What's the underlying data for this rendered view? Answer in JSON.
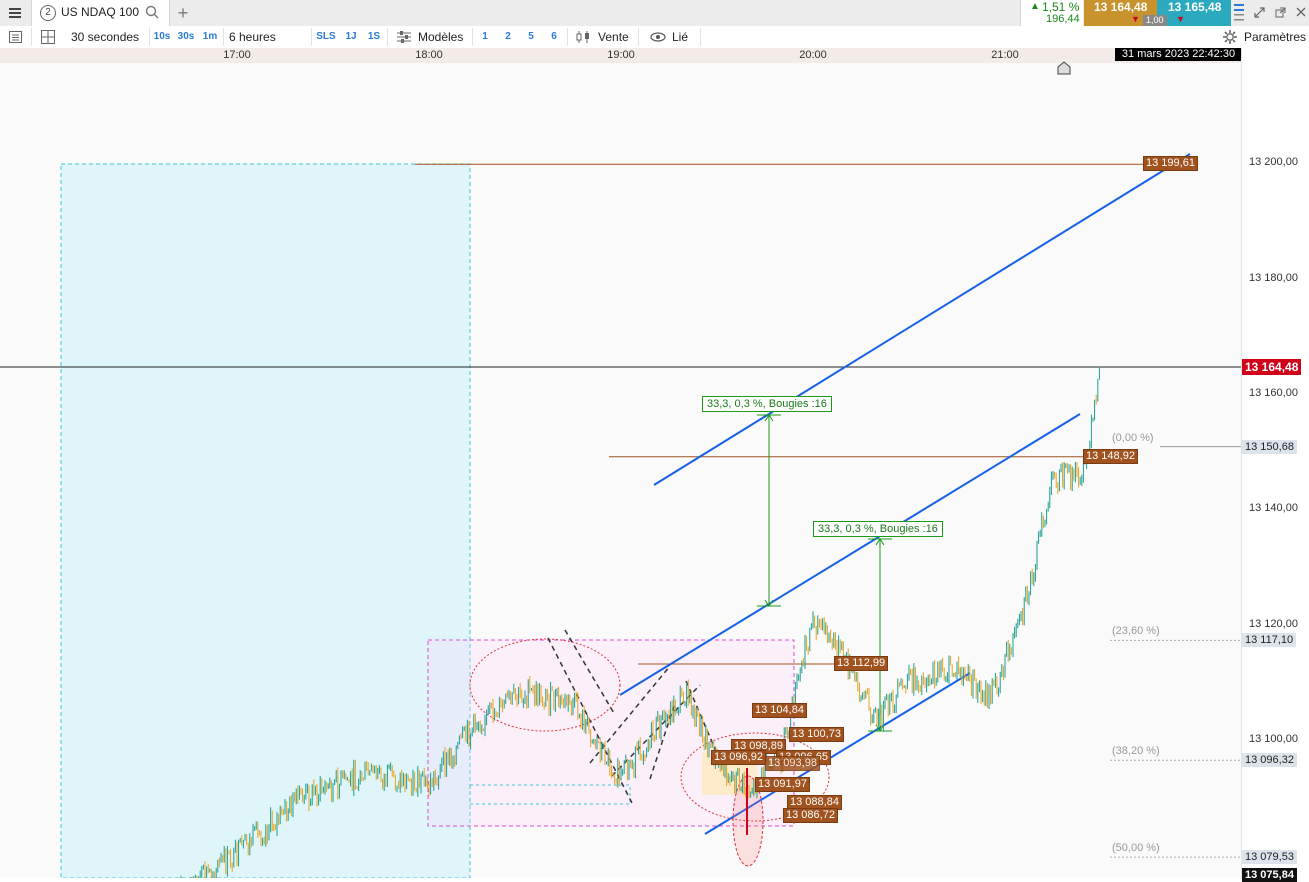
{
  "header": {
    "tab_number": "2",
    "instrument": "US NDAQ 100",
    "change_pct": "1,51 %",
    "change_abs": "196,44",
    "bid": "13 164,48",
    "ask": "13 165,48",
    "spread": "1,00"
  },
  "toolbar": {
    "period": "30 secondes",
    "btn_10s": "10s",
    "btn_30s": "30s",
    "btn_1m": "1m",
    "range": "6 heures",
    "btn_sls": "SLS",
    "btn_1j": "1J",
    "btn_1s": "1S",
    "models": "Modèles",
    "n1": "1",
    "n2": "2",
    "n5": "5",
    "n6": "6",
    "sell": "Vente",
    "linked": "Lié",
    "settings": "Paramètres"
  },
  "colors": {
    "up": "#1a9e8f",
    "down": "#e8a21c",
    "trend": "#1560e8",
    "level": "#a0521f",
    "measure": "#1b9a1b",
    "bid_bg": "#c8922c",
    "ask_bg": "#2aa9bf",
    "last_price_bg": "#d0021b"
  },
  "chart_data": {
    "type": "candlestick",
    "x_ticks": [
      "17:00",
      "18:00",
      "19:00",
      "20:00",
      "21:00"
    ],
    "datetime": "31 mars 2023 22:42:30",
    "y_ticks": [
      "13 200,00",
      "13 180,00",
      "13 160,00",
      "13 140,00",
      "13 120,00",
      "13 100,00"
    ],
    "ylim": [
      13073,
      13212
    ],
    "last_price": "13 164,48",
    "axis_marks": [
      {
        "label": "13 150,68",
        "value": 13150.68
      },
      {
        "label": "13 117,10",
        "value": 13117.1
      },
      {
        "label": "13 096,32",
        "value": 13096.32
      },
      {
        "label": "13 079,53",
        "value": 13079.53
      },
      {
        "label": "13 075,84",
        "value": 13075.84
      }
    ],
    "fib_levels": [
      {
        "label": "(0,00 %)",
        "value": 13150.68
      },
      {
        "label": "(23,60 %)",
        "value": 13117.1
      },
      {
        "label": "(38,20 %)",
        "value": 13096.32
      },
      {
        "label": "(50,00 %)",
        "value": 13079.53
      }
    ],
    "level_tags": [
      {
        "label": "13 199,61",
        "value": 13199.61
      },
      {
        "label": "13 148,92",
        "value": 13148.92
      },
      {
        "label": "13 112,99",
        "value": 13112.99
      },
      {
        "label": "13 104,84",
        "value": 13104.84
      },
      {
        "label": "13 100,73",
        "value": 13100.73
      },
      {
        "label": "13 098,89",
        "value": 13098.89
      },
      {
        "label": "13 096,92",
        "value": 13096.92
      },
      {
        "label": "13 096,65",
        "value": 13096.65
      },
      {
        "label": "13 093,98",
        "value": 13093.98
      },
      {
        "label": "13 091,97",
        "value": 13091.97
      },
      {
        "label": "13 088,84",
        "value": 13088.84
      },
      {
        "label": "13 086,72",
        "value": 13086.72
      }
    ],
    "measurements": [
      {
        "label": "33,3, 0,3 %, Bougies :16"
      },
      {
        "label": "33,3, 0,3 %, Bougies :16"
      }
    ],
    "price_path": [
      [
        "16:40",
        13073
      ],
      [
        "17:00",
        13080
      ],
      [
        "17:20",
        13090
      ],
      [
        "17:40",
        13094
      ],
      [
        "18:00",
        13092
      ],
      [
        "18:15",
        13103
      ],
      [
        "18:30",
        13108
      ],
      [
        "18:45",
        13106
      ],
      [
        "19:00",
        13093
      ],
      [
        "19:10",
        13101
      ],
      [
        "19:20",
        13108
      ],
      [
        "19:30",
        13096
      ],
      [
        "19:40",
        13091
      ],
      [
        "19:50",
        13097
      ],
      [
        "20:00",
        13121
      ],
      [
        "20:10",
        13114
      ],
      [
        "20:20",
        13103
      ],
      [
        "20:30",
        13110
      ],
      [
        "20:45",
        13112
      ],
      [
        "20:55",
        13107
      ],
      [
        "21:05",
        13120
      ],
      [
        "21:15",
        13145
      ],
      [
        "21:25",
        13146
      ],
      [
        "21:30",
        13164
      ]
    ]
  }
}
